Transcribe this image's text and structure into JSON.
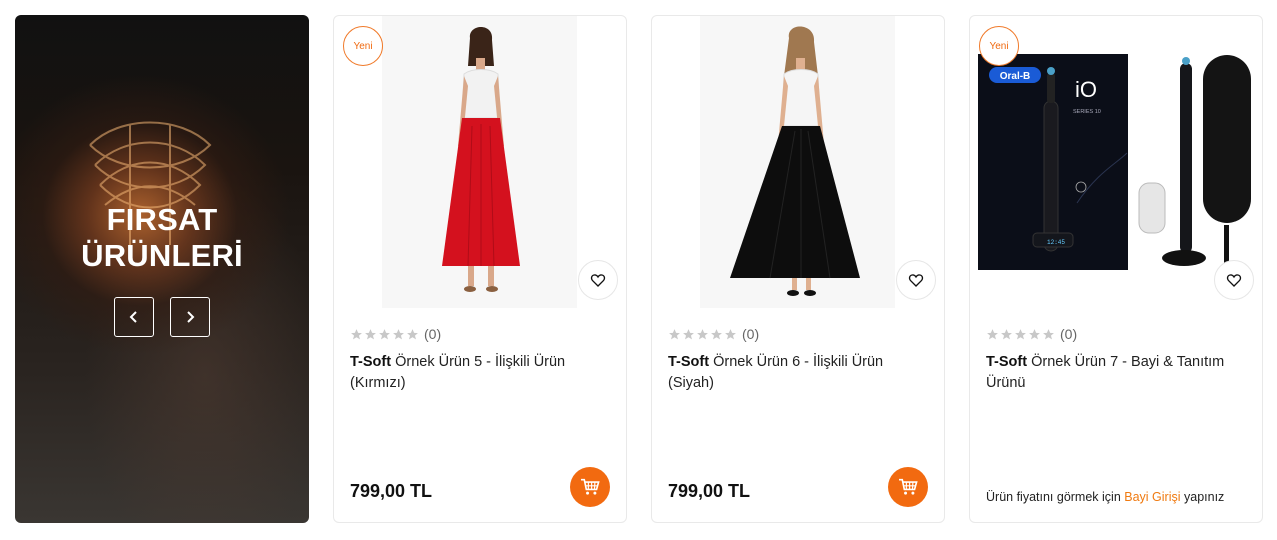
{
  "promo": {
    "title_line1": "FIRSAT",
    "title_line2": "ÜRÜNLERİ",
    "prev_icon": "chevron-left-icon",
    "next_icon": "chevron-right-icon"
  },
  "products": [
    {
      "badge": "Yeni",
      "rating_count": "(0)",
      "brand": "T-Soft",
      "name": " Örnek Ürün 5 - İlişkili Ürün (Kırmızı)",
      "price": "799,00 TL"
    },
    {
      "badge": "",
      "rating_count": "(0)",
      "brand": "T-Soft",
      "name": " Örnek Ürün 6 - İlişkili Ürün (Siyah)",
      "price": "799,00 TL"
    },
    {
      "badge": "Yeni",
      "rating_count": "(0)",
      "brand": "T-Soft",
      "name": " Örnek Ürün 7 - Bayi & Tanıtım Ürünü",
      "price_note_prefix": "Ürün fiyatını görmek için ",
      "price_note_link": "Bayi Girişi",
      "price_note_suffix": " yapınız",
      "image_brand_text": "Oral-B",
      "image_model_text": "iO",
      "image_series_text": "SERIES 10",
      "image_clock_text": "12:45"
    }
  ],
  "colors": {
    "accent": "#f26a10",
    "star": "#c8c8c8"
  }
}
